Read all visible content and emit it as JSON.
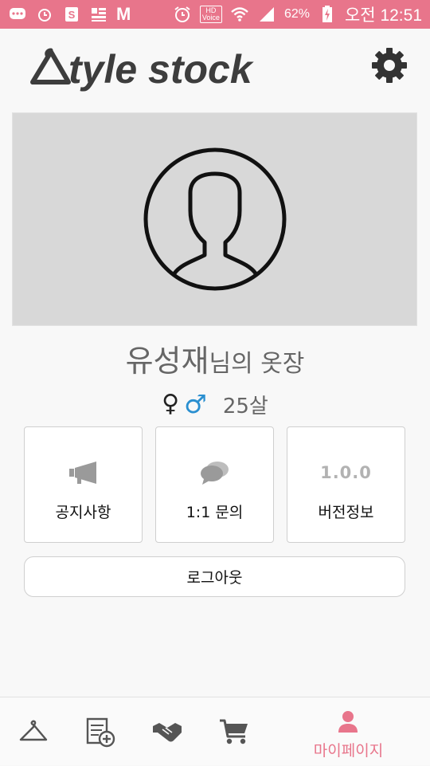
{
  "status_bar": {
    "battery_percent": "62%",
    "time": "오전 12:51",
    "hd_label": "HD",
    "voice_label": "Voice",
    "m_label": "M",
    "background": "#e8758b"
  },
  "header": {
    "logo_text": "tyle stock",
    "settings_icon": "gear-icon"
  },
  "profile": {
    "name": "유성재",
    "name_suffix": "님의 옷장",
    "female_symbol": "♀",
    "male_symbol": "♂",
    "age": "25살"
  },
  "cards": [
    {
      "label": "공지사항",
      "icon": "megaphone-icon"
    },
    {
      "label": "1:1 문의",
      "icon": "chat-bubbles-icon"
    },
    {
      "label": "버전정보",
      "version": "1.0.0"
    }
  ],
  "logout_label": "로그아웃",
  "bottom_nav": {
    "items": [
      {
        "icon": "hanger-icon"
      },
      {
        "icon": "add-document-icon"
      },
      {
        "icon": "handshake-icon"
      },
      {
        "icon": "cart-icon"
      },
      {
        "icon": "person-icon",
        "label": "마이페이지",
        "active": true
      }
    ],
    "active_color": "#e8758b"
  }
}
